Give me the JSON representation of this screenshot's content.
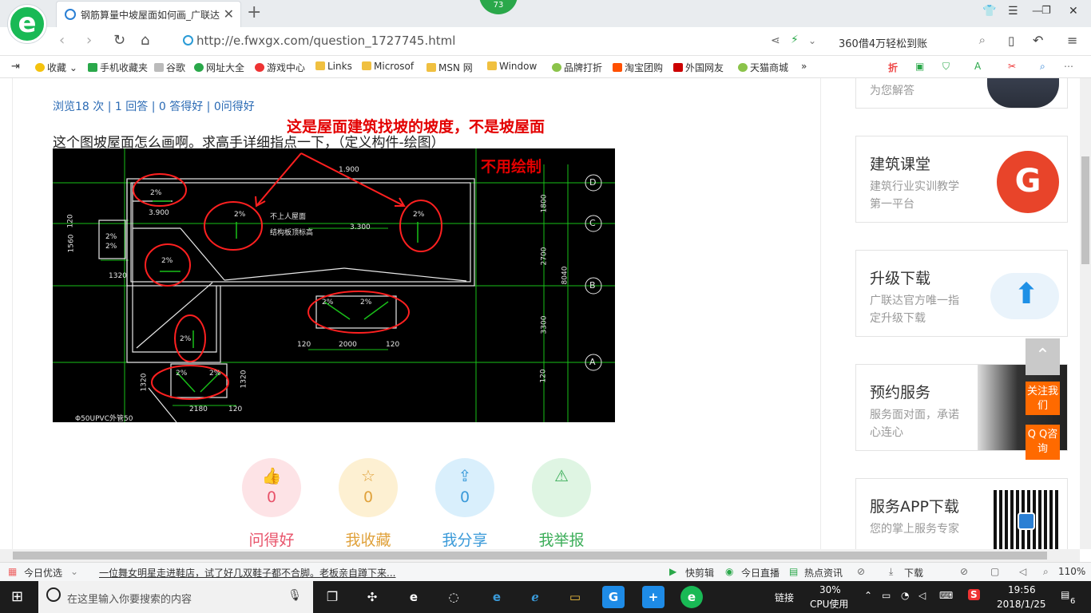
{
  "browser": {
    "tab_title": "钢筋算量中坡屋面如何画_广联达",
    "badge": "73",
    "url": "http://e.fwxgx.com/question_1727745.html",
    "search_text": "360借4万轻松到账"
  },
  "bookmarks": [
    {
      "label": "收藏",
      "color": "#f4c20d"
    },
    {
      "label": "手机收藏夹",
      "color": "#2aa84a"
    },
    {
      "label": "谷歌",
      "color": "#bbbbbb"
    },
    {
      "label": "网址大全",
      "color": "#2aa84a"
    },
    {
      "label": "游戏中心",
      "color": "#e33"
    },
    {
      "label": "Links",
      "color": "#f0c040"
    },
    {
      "label": "Microsof",
      "color": "#f0c040"
    },
    {
      "label": "MSN 网",
      "color": "#f0c040"
    },
    {
      "label": "Window",
      "color": "#f0c040"
    },
    {
      "label": "品牌打折",
      "color": "#8bc34a"
    },
    {
      "label": "淘宝团购",
      "color": "#ff5000"
    },
    {
      "label": "外国网友",
      "color": "#c00"
    },
    {
      "label": "天猫商城",
      "color": "#8bc34a"
    }
  ],
  "question": {
    "stats": "浏览18 次 | 1 回答 | 0 答得好 | 0问得好",
    "text": "这个图坡屋面怎么画啊。求高手详细指点一下，（定义构件-绘图）",
    "annotation": "这是屋面建筑找坡的坡度，不是坡屋面",
    "image_note": "不用绘制"
  },
  "cad_labels": {
    "slope": "2%",
    "roof1": "不上人屋面",
    "roof2": "结构板顶标高",
    "d3900": "3.900",
    "d3300": "3.300",
    "d2000": "2000",
    "d2180": "2180",
    "d1320": "1320",
    "d120": "120",
    "d1800": "1800",
    "d2700": "2700",
    "d3300v": "3300",
    "d8040": "8040",
    "d1900": "1.900",
    "d1560": "1560",
    "pipe": "Φ50UPVC外管50",
    "axes": [
      "D",
      "C",
      "B",
      "A"
    ]
  },
  "actions": [
    {
      "label": "问得好",
      "count": "0",
      "icon": "👍",
      "bg": "#fde3e6",
      "fg": "#e8536a"
    },
    {
      "label": "我收藏",
      "count": "0",
      "icon": "☆",
      "bg": "#fdf0d2",
      "fg": "#e0a23c"
    },
    {
      "label": "我分享",
      "count": "0",
      "icon": "⇪",
      "bg": "#d9effc",
      "fg": "#3a9ad9"
    },
    {
      "label": "我举报",
      "count": "0",
      "icon": "⚠",
      "bg": "#dff5e3",
      "fg": "#3dae5a"
    }
  ],
  "sidebar": {
    "top_card_desc": "为您解答",
    "cards": [
      {
        "title": "建筑课堂",
        "desc": "建筑行业实训教学第一平台"
      },
      {
        "title": "升级下载",
        "desc": "广联达官方唯一指定升级下载"
      },
      {
        "title": "预约服务",
        "desc": "服务面对面，承诺心连心"
      },
      {
        "title": "服务APP下载",
        "desc": "您的掌上服务专家"
      }
    ],
    "float_follow": "关注我们",
    "float_qq": "Q Q咨询"
  },
  "statusbar": {
    "today": "今日优选",
    "news": "一位舞女明星走进鞋店，试了好几双鞋子都不合脚。老板亲自蹲下来...",
    "items": [
      "快剪辑",
      "今日直播",
      "热点资讯",
      "下载"
    ],
    "zoom": "110%"
  },
  "taskbar": {
    "search_placeholder": "在这里输入你要搜索的内容",
    "link": "链接",
    "cpu_percent": "30%",
    "cpu_label": "CPU使用",
    "time": "19:56",
    "date": "2018/1/25",
    "notif": "6"
  }
}
